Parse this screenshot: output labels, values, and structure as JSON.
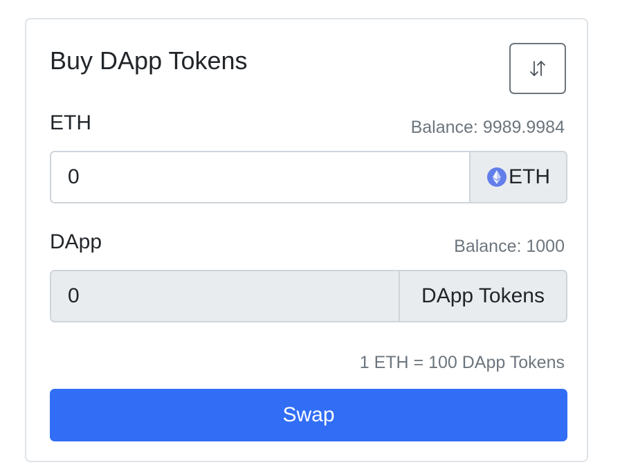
{
  "card": {
    "title": "Buy DApp Tokens",
    "toggle_icon": "swap-vertical-arrows-icon"
  },
  "input_token": {
    "label": "ETH",
    "balance_text": "Balance: 9989.9984",
    "value": "0",
    "addon_label": "ETH",
    "addon_icon": "ethereum-logo-icon"
  },
  "output_token": {
    "label": "DApp",
    "balance_text": "Balance: 1000",
    "value": "0",
    "addon_label": "DApp Tokens"
  },
  "rate_text": "1 ETH = 100 DApp Tokens",
  "swap_button_label": "Swap",
  "colors": {
    "primary": "#316ef5",
    "muted_text": "#6c757d",
    "addon_bg": "#e9ecef",
    "eth_logo": "#627eea"
  }
}
